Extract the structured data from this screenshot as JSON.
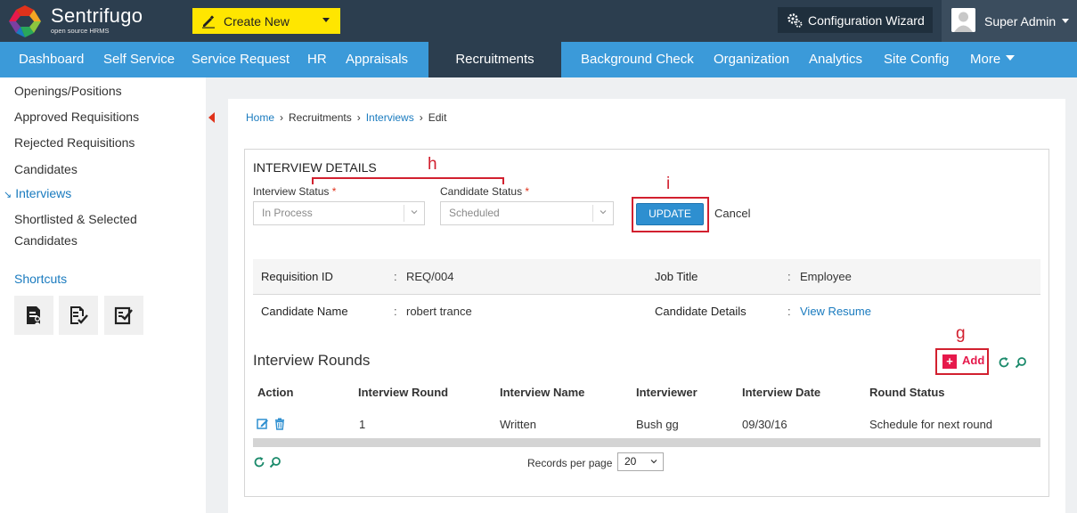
{
  "header": {
    "brand": "Sentrifugo",
    "brand_sub": "open source HRMS",
    "create_new_label": "Create New",
    "config_wizard_label": "Configuration Wizard",
    "user_name": "Super Admin"
  },
  "nav": {
    "items": [
      "Dashboard",
      "Self Service",
      "Service Request",
      "HR",
      "Appraisals",
      "Recruitments",
      "Background Check",
      "Organization",
      "Analytics",
      "Site Config",
      "More"
    ],
    "active": "Recruitments"
  },
  "sidebar": {
    "items": [
      "Openings/Positions",
      "Approved Requisitions",
      "Rejected Requisitions",
      "Candidates",
      "Interviews",
      "Shortlisted & Selected",
      "Candidates"
    ],
    "active": "Interviews",
    "shortcuts_title": "Shortcuts",
    "shortcut_icons": [
      "requisition-shortcut-icon",
      "candidate-shortcut-icon",
      "interview-shortcut-icon"
    ]
  },
  "breadcrumb": [
    "Home",
    "Recruitments",
    "Interviews",
    "Edit"
  ],
  "interview_details": {
    "title": "INTERVIEW DETAILS",
    "interview_status_label": "Interview Status",
    "interview_status_value": "In Process",
    "candidate_status_label": "Candidate Status",
    "candidate_status_value": "Scheduled",
    "required_mark": "*",
    "update_label": "UPDATE",
    "cancel_label": "Cancel"
  },
  "info": {
    "colon": ":",
    "requisition_id_label": "Requisition ID",
    "requisition_id_value": "REQ/004",
    "job_title_label": "Job Title",
    "job_title_value": "Employee",
    "candidate_name_label": "Candidate Name",
    "candidate_name_value": "robert trance",
    "candidate_details_label": "Candidate Details",
    "candidate_details_value": "View Resume"
  },
  "rounds": {
    "title": "Interview Rounds",
    "add_label": "Add",
    "add_plus": "+",
    "columns": [
      "Action",
      "Interview Round",
      "Interview Name",
      "Interviewer",
      "Interview Date",
      "Round Status"
    ],
    "rows": [
      {
        "round": "1",
        "name": "Written",
        "interviewer": "Bush gg",
        "date": "09/30/16",
        "status": "Schedule for next round"
      }
    ],
    "records_per_page_label": "Records per page",
    "records_per_page_value": "20"
  },
  "annotations": {
    "h": "h",
    "i": "i",
    "g": "g"
  },
  "colors": {
    "topbar": "#2c3e4f",
    "nav": "#3b9ad9",
    "create_new": "#ffe600",
    "link": "#1a7bbf",
    "annotation": "#d2202f"
  }
}
